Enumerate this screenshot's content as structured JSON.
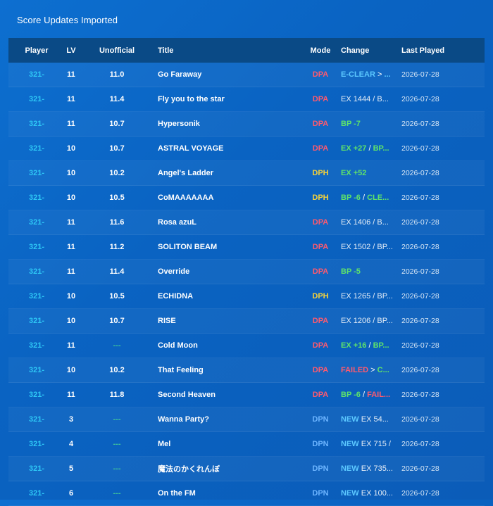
{
  "page_title": "Score Updates Imported",
  "colors": {
    "DPA": "#ff5a6e",
    "DPH": "#f5d23a",
    "DPN": "#6cb4ff",
    "green": "#5fe36a",
    "red": "#ff5a6e",
    "blue": "#5cc8ff",
    "player": "#2ec7f5",
    "dash": "#3ec39a"
  },
  "columns": {
    "player": "Player",
    "lv": "LV",
    "unofficial": "Unofficial",
    "title": "Title",
    "mode": "Mode",
    "change": "Change",
    "last_played": "Last Played"
  },
  "rows": [
    {
      "player": "321-",
      "lv": "11",
      "unofficial": "11.0",
      "title": "Go Faraway",
      "mode": "DPA",
      "last_played": "2026-07-28",
      "change": [
        {
          "t": "E-CLEAR",
          "c": "blue"
        },
        {
          "t": " > ",
          "c": "sep"
        },
        {
          "t": "...",
          "c": "blue"
        }
      ]
    },
    {
      "player": "321-",
      "lv": "11",
      "unofficial": "11.4",
      "title": "Fly you to the star",
      "mode": "DPA",
      "last_played": "2026-07-28",
      "change": [
        {
          "t": "EX 1444 / B...",
          "c": "plain"
        }
      ]
    },
    {
      "player": "321-",
      "lv": "11",
      "unofficial": "10.7",
      "title": "Hypersonik",
      "mode": "DPA",
      "last_played": "2026-07-28",
      "change": [
        {
          "t": "BP -7",
          "c": "green"
        }
      ]
    },
    {
      "player": "321-",
      "lv": "10",
      "unofficial": "10.7",
      "title": "ASTRAL VOYAGE",
      "mode": "DPA",
      "last_played": "2026-07-28",
      "change": [
        {
          "t": "EX +27",
          "c": "green"
        },
        {
          "t": " / ",
          "c": "sep"
        },
        {
          "t": "BP...",
          "c": "green"
        }
      ]
    },
    {
      "player": "321-",
      "lv": "10",
      "unofficial": "10.2",
      "title": "Angel's Ladder",
      "mode": "DPH",
      "last_played": "2026-07-28",
      "change": [
        {
          "t": "EX +52",
          "c": "green"
        }
      ]
    },
    {
      "player": "321-",
      "lv": "10",
      "unofficial": "10.5",
      "title": "CoMAAAAAAA",
      "mode": "DPH",
      "last_played": "2026-07-28",
      "change": [
        {
          "t": "BP -6",
          "c": "green"
        },
        {
          "t": " / ",
          "c": "sep"
        },
        {
          "t": "CLE...",
          "c": "green"
        }
      ]
    },
    {
      "player": "321-",
      "lv": "11",
      "unofficial": "11.6",
      "title": "Rosa azuL",
      "mode": "DPA",
      "last_played": "2026-07-28",
      "change": [
        {
          "t": "EX 1406 / B...",
          "c": "plain"
        }
      ]
    },
    {
      "player": "321-",
      "lv": "11",
      "unofficial": "11.2",
      "title": "SOLITON BEAM",
      "mode": "DPA",
      "last_played": "2026-07-28",
      "change": [
        {
          "t": "EX 1502 / BP...",
          "c": "plain"
        }
      ]
    },
    {
      "player": "321-",
      "lv": "11",
      "unofficial": "11.4",
      "title": "Override",
      "mode": "DPA",
      "last_played": "2026-07-28",
      "change": [
        {
          "t": "BP -5",
          "c": "green"
        }
      ]
    },
    {
      "player": "321-",
      "lv": "10",
      "unofficial": "10.5",
      "title": "ECHIDNA",
      "mode": "DPH",
      "last_played": "2026-07-28",
      "change": [
        {
          "t": "EX 1265 / BP...",
          "c": "plain"
        }
      ]
    },
    {
      "player": "321-",
      "lv": "10",
      "unofficial": "10.7",
      "title": "RISE",
      "mode": "DPA",
      "last_played": "2026-07-28",
      "change": [
        {
          "t": "EX 1206 / BP...",
          "c": "plain"
        }
      ]
    },
    {
      "player": "321-",
      "lv": "11",
      "unofficial": "---",
      "title": "Cold Moon",
      "mode": "DPA",
      "last_played": "2026-07-28",
      "change": [
        {
          "t": "EX +16",
          "c": "green"
        },
        {
          "t": " / ",
          "c": "sep"
        },
        {
          "t": "BP...",
          "c": "green"
        }
      ]
    },
    {
      "player": "321-",
      "lv": "10",
      "unofficial": "10.2",
      "title": "That Feeling",
      "mode": "DPA",
      "last_played": "2026-07-28",
      "change": [
        {
          "t": "FAILED",
          "c": "red"
        },
        {
          "t": " > ",
          "c": "sep"
        },
        {
          "t": "C...",
          "c": "green"
        }
      ]
    },
    {
      "player": "321-",
      "lv": "11",
      "unofficial": "11.8",
      "title": "Second Heaven",
      "mode": "DPA",
      "last_played": "2026-07-28",
      "change": [
        {
          "t": "BP -6",
          "c": "green"
        },
        {
          "t": " / ",
          "c": "sep"
        },
        {
          "t": "FAIL...",
          "c": "red"
        }
      ]
    },
    {
      "player": "321-",
      "lv": "3",
      "unofficial": "---",
      "title": "Wanna Party?",
      "mode": "DPN",
      "last_played": "2026-07-28",
      "change": [
        {
          "t": "NEW",
          "c": "blue"
        },
        {
          "t": " EX 54...",
          "c": "plain"
        }
      ]
    },
    {
      "player": "321-",
      "lv": "4",
      "unofficial": "---",
      "title": "Mel",
      "mode": "DPN",
      "last_played": "2026-07-28",
      "change": [
        {
          "t": "NEW",
          "c": "blue"
        },
        {
          "t": " EX 715 /",
          "c": "plain"
        }
      ]
    },
    {
      "player": "321-",
      "lv": "5",
      "unofficial": "---",
      "title": "魔法のかくれんぼ",
      "mode": "DPN",
      "last_played": "2026-07-28",
      "change": [
        {
          "t": "NEW",
          "c": "blue"
        },
        {
          "t": " EX 735...",
          "c": "plain"
        }
      ]
    },
    {
      "player": "321-",
      "lv": "6",
      "unofficial": "---",
      "title": "On the FM",
      "mode": "DPN",
      "last_played": "2026-07-28",
      "change": [
        {
          "t": "NEW",
          "c": "blue"
        },
        {
          "t": " EX 100...",
          "c": "plain"
        }
      ]
    }
  ]
}
